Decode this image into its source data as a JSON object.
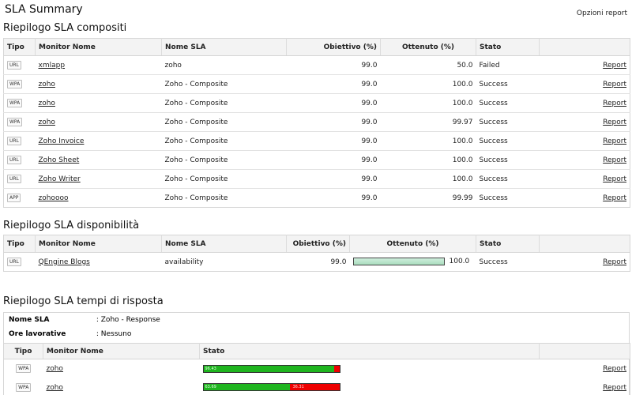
{
  "page": {
    "title": "SLA Summary",
    "options_label": "Opzioni report"
  },
  "composite": {
    "title": "Riepilogo SLA compositi",
    "columns": [
      "Tipo",
      "Monitor Nome",
      "Nome SLA",
      "Obiettivo (%)",
      "Ottenuto (%)",
      "Stato",
      ""
    ],
    "rows": [
      {
        "type": "URL",
        "monitor": "xmlapp",
        "sla": "zoho",
        "target": "99.0",
        "achieved": "50.0",
        "status": "Failed",
        "report": "Report"
      },
      {
        "type": "WPA",
        "monitor": "zoho",
        "sla": "Zoho - Composite",
        "target": "99.0",
        "achieved": "100.0",
        "status": "Success",
        "report": "Report"
      },
      {
        "type": "WPA",
        "monitor": "zoho",
        "sla": "Zoho - Composite",
        "target": "99.0",
        "achieved": "100.0",
        "status": "Success",
        "report": "Report"
      },
      {
        "type": "WPA",
        "monitor": "zoho",
        "sla": "Zoho - Composite",
        "target": "99.0",
        "achieved": "99.97",
        "status": "Success",
        "report": "Report"
      },
      {
        "type": "URL",
        "monitor": "Zoho Invoice",
        "sla": "Zoho - Composite",
        "target": "99.0",
        "achieved": "100.0",
        "status": "Success",
        "report": "Report"
      },
      {
        "type": "URL",
        "monitor": "Zoho Sheet",
        "sla": "Zoho - Composite",
        "target": "99.0",
        "achieved": "100.0",
        "status": "Success",
        "report": "Report"
      },
      {
        "type": "URL",
        "monitor": "Zoho Writer",
        "sla": "Zoho - Composite",
        "target": "99.0",
        "achieved": "100.0",
        "status": "Success",
        "report": "Report"
      },
      {
        "type": "APP",
        "monitor": "zohoooo",
        "sla": "Zoho - Composite",
        "target": "99.0",
        "achieved": "99.99",
        "status": "Success",
        "report": "Report"
      }
    ]
  },
  "availability": {
    "title": "Riepilogo SLA disponibilità",
    "columns": [
      "Tipo",
      "Monitor Nome",
      "Nome SLA",
      "Obiettivo (%)",
      "Ottenuto (%)",
      "Stato",
      ""
    ],
    "rows": [
      {
        "type": "URL",
        "monitor": "QEngine Blogs",
        "sla": "availability",
        "target": "99.0",
        "achieved": "100.0",
        "achieved_pct": 100,
        "status": "Success",
        "report": "Report"
      }
    ]
  },
  "response": {
    "title": "Riepilogo SLA tempi di risposta",
    "sla_name_label": "Nome SLA",
    "sla_name_value": ":  Zoho - Response",
    "hours_label": "Ore lavorative",
    "hours_value": ":  Nessuno",
    "columns": [
      "Tipo",
      "Monitor Nome",
      "Stato",
      ""
    ],
    "rows": [
      {
        "type": "WPA",
        "monitor": "zoho",
        "green_pct": 96.43,
        "green_label": "96.43",
        "red_label": "",
        "report": "Report"
      },
      {
        "type": "WPA",
        "monitor": "zoho",
        "green_pct": 63.69,
        "green_label": "63.69",
        "red_label": "36.31",
        "report": "Report"
      }
    ]
  },
  "colors": {
    "bar_green": "#1fb51f",
    "bar_red": "#e00000",
    "avail_fill": "#a9dcbd"
  }
}
